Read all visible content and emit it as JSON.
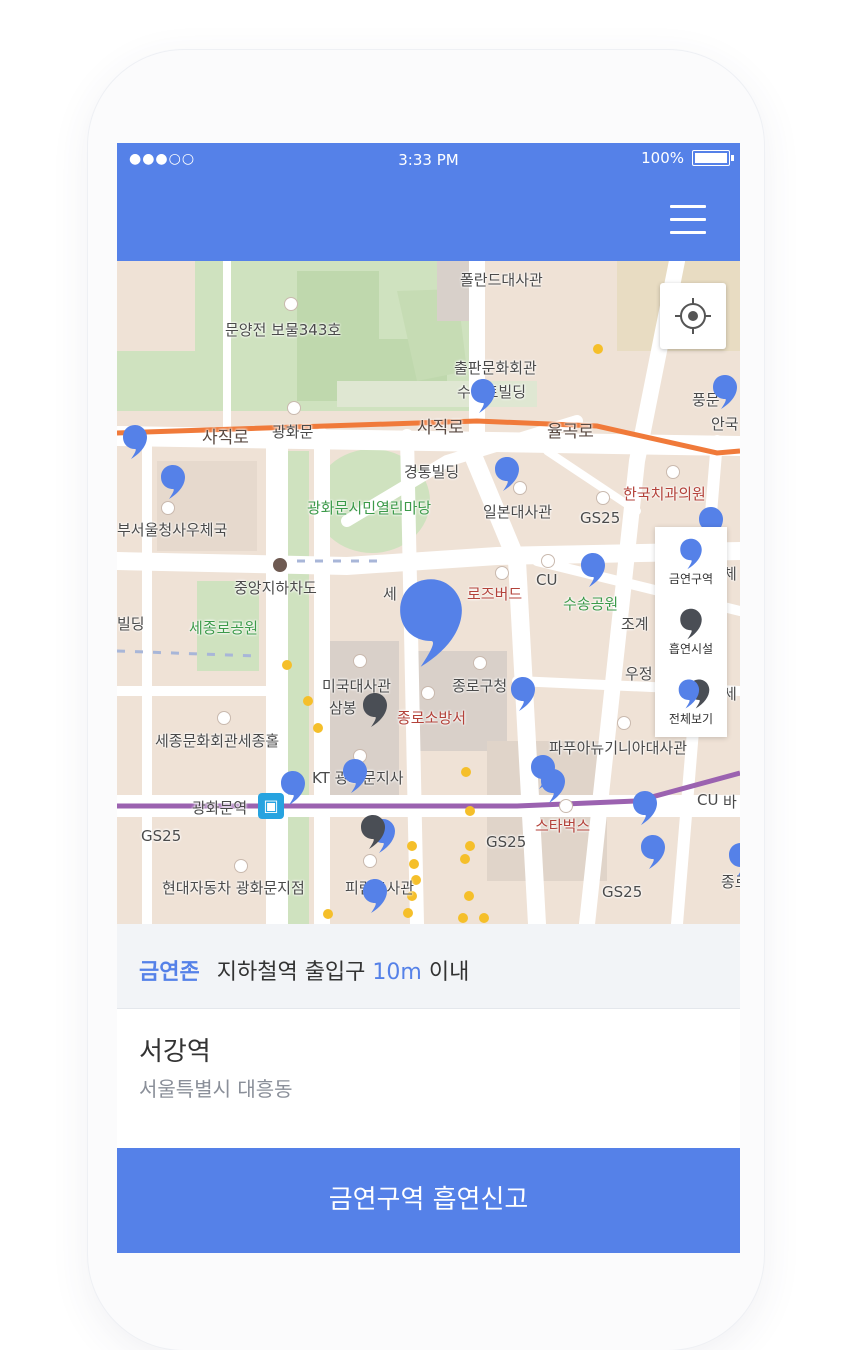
{
  "status_bar": {
    "signal": "●●●○○",
    "time": "3:33 PM",
    "battery": "100%"
  },
  "header": {
    "menu_icon": "hamburger-menu-icon",
    "bg_color": "#5581e8"
  },
  "map": {
    "labels": {
      "poland_embassy": "폴란드대사관",
      "munyangjeon": "문양전 보물343호",
      "publishing": "출판문화회관",
      "susong": "수송트빌딩",
      "sajikro": "사직로",
      "gwanghwamun": "광화문",
      "sajikro2": "사직로",
      "yulgokro": "율곡로",
      "pungmun": "풍문",
      "anguk": "안국",
      "gyeongtong": "경통빌딩",
      "plaza": "광화문시민열린마당",
      "dental": "한국치과의원",
      "post_office": "부서울청사우체국",
      "japan_embassy": "일본대사관",
      "gs25_a": "GS25",
      "underground": "중앙지하차도",
      "cu_a": "CU",
      "rosebud": "로즈버드",
      "sejong_partial": "세",
      "susong_park": "수송공원",
      "building": "빌딩",
      "sejongro_park": "세종로공원",
      "jogye": "조계",
      "uijeong": "우정",
      "us_embassy": "미국대사관",
      "jongno_office": "종로구청",
      "samsung": "삼봉",
      "fire_station": "종로소방서",
      "sejong_center": "세종문화회관세종홀",
      "papua": "파푸아뉴기니아대사관",
      "kt": "KT 광화문지사",
      "gwanghwamun_station": "광화문역",
      "cu_b": "CU",
      "gs25_b": "GS25",
      "starbucks": "스타벅스",
      "gs25_c": "GS25",
      "hyundai": "현대자동차 광화문지점",
      "pinan": "피란드사관",
      "gs25_d": "GS25",
      "jong": "종로",
      "che": "체",
      "se": "세",
      "ba": "바"
    },
    "filters": [
      {
        "label": "금연구역",
        "icon": "blue-comma-marker-icon"
      },
      {
        "label": "흡연시설",
        "icon": "dark-comma-marker-icon"
      },
      {
        "label": "전체보기",
        "icon": "all-markers-icon"
      }
    ],
    "colors": {
      "marker_blue": "#5581e8",
      "marker_dark": "#4a4e55",
      "road_orange": "#f07a3a",
      "subway_purple": "#9b62b0"
    }
  },
  "info": {
    "zone_label": "금연존",
    "description_prefix": "지하철역 출입구",
    "distance": "10m",
    "description_suffix": "이내"
  },
  "place": {
    "name": "서강역",
    "address": "서울특별시 대흥동"
  },
  "actions": {
    "report_label": "금연구역 흡연신고"
  }
}
